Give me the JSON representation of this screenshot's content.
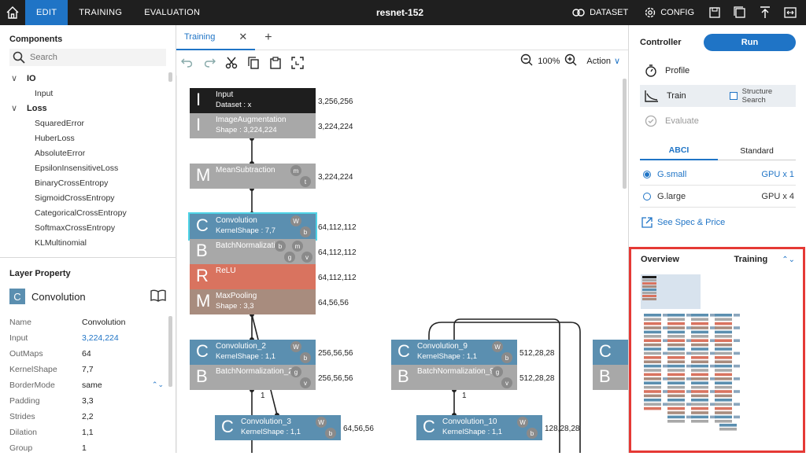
{
  "app": {
    "title": "resnet-152"
  },
  "nav": {
    "tabs": [
      "EDIT",
      "TRAINING",
      "EVALUATION"
    ]
  },
  "top_actions": {
    "dataset": "DATASET",
    "config": "CONFIG"
  },
  "components": {
    "header": "Components",
    "search_placeholder": "Search",
    "groups": [
      {
        "label": "IO",
        "items": [
          "Input"
        ]
      },
      {
        "label": "Loss",
        "items": [
          "SquaredError",
          "HuberLoss",
          "AbsoluteError",
          "EpsilonInsensitiveLoss",
          "BinaryCrossEntropy",
          "SigmoidCrossEntropy",
          "CategoricalCrossEntropy",
          "SoftmaxCrossEntropy",
          "KLMultinomial"
        ]
      }
    ]
  },
  "layer_property": {
    "header": "Layer Property",
    "type_letter": "C",
    "type_name": "Convolution",
    "rows": [
      {
        "key": "Name",
        "value": "Convolution"
      },
      {
        "key": "Input",
        "value": "3,224,224"
      },
      {
        "key": "OutMaps",
        "value": "64"
      },
      {
        "key": "KernelShape",
        "value": "7,7"
      },
      {
        "key": "BorderMode",
        "value": "same"
      },
      {
        "key": "Padding",
        "value": "3,3"
      },
      {
        "key": "Strides",
        "value": "2,2"
      },
      {
        "key": "Dilation",
        "value": "1,1"
      },
      {
        "key": "Group",
        "value": "1"
      }
    ]
  },
  "editor": {
    "tab_label": "Training",
    "zoom": "100%",
    "action_label": "Action"
  },
  "graph": {
    "nodes": [
      {
        "letter": "I",
        "name": "Input",
        "sub": "Dataset : x",
        "shape": "3,256,256",
        "ports": []
      },
      {
        "letter": "I",
        "name": "ImageAugmentation",
        "sub": "Shape : 3,224,224",
        "shape": "3,224,224",
        "ports": []
      },
      {
        "letter": "M",
        "name": "MeanSubtraction",
        "sub": "",
        "shape": "3,224,224",
        "ports": [
          "m",
          "t"
        ]
      },
      {
        "letter": "C",
        "name": "Convolution",
        "sub": "KernelShape : 7,7",
        "shape": "64,112,112",
        "ports": [
          "W",
          "b"
        ]
      },
      {
        "letter": "B",
        "name": "BatchNormalization",
        "sub": "",
        "shape": "64,112,112",
        "ports": [
          "b",
          "g",
          "m",
          "v"
        ]
      },
      {
        "letter": "R",
        "name": "ReLU",
        "sub": "",
        "shape": "64,112,112",
        "ports": []
      },
      {
        "letter": "M",
        "name": "MaxPooling",
        "sub": "Shape : 3,3",
        "shape": "64,56,56",
        "ports": []
      },
      {
        "letter": "C",
        "name": "Convolution_2",
        "sub": "KernelShape : 1,1",
        "shape": "256,56,56",
        "ports": [
          "W",
          "b"
        ]
      },
      {
        "letter": "B",
        "name": "BatchNormalization_2",
        "sub": "",
        "shape": "256,56,56",
        "ports": [
          "g",
          "v"
        ]
      },
      {
        "letter": "C",
        "name": "Convolution_3",
        "sub": "KernelShape : 1,1",
        "shape": "64,56,56",
        "ports": [
          "W",
          "b"
        ]
      },
      {
        "letter": "C",
        "name": "Convolution_9",
        "sub": "KernelShape : 1,1",
        "shape": "512,28,28",
        "ports": [
          "W",
          "b"
        ]
      },
      {
        "letter": "B",
        "name": "BatchNormalization_9",
        "sub": "",
        "shape": "512,28,28",
        "ports": [
          "g",
          "v"
        ]
      },
      {
        "letter": "C",
        "name": "Convolution_10",
        "sub": "KernelShape : 1,1",
        "shape": "128,28,28",
        "ports": [
          "W",
          "b"
        ]
      },
      {
        "letter": "C",
        "name": "",
        "sub": "",
        "shape": "",
        "ports": []
      },
      {
        "letter": "B",
        "name": "",
        "sub": "",
        "shape": "",
        "ports": []
      }
    ],
    "edge_labels": [
      "1",
      "1"
    ]
  },
  "controller": {
    "title": "Controller",
    "run_label": "Run",
    "items": [
      {
        "label": "Profile"
      },
      {
        "label": "Train"
      },
      {
        "label": "Evaluate"
      }
    ],
    "structure_search": "Structure Search",
    "tabs": [
      "ABCI",
      "Standard"
    ],
    "instances": [
      {
        "name": "G.small",
        "gpu": "GPU x 1"
      },
      {
        "name": "G.large",
        "gpu": "GPU x 4"
      }
    ],
    "spec_link": "See Spec & Price"
  },
  "overview": {
    "title": "Overview",
    "selected": "Training"
  },
  "colors": {
    "accent": "#1f74c6",
    "conv": "#5b8fb0",
    "batchnorm": "#a8a8a8",
    "relu": "#d9735f",
    "pool": "#a88c7e",
    "input": "#1e1e1e",
    "highlight": "#e53935"
  }
}
